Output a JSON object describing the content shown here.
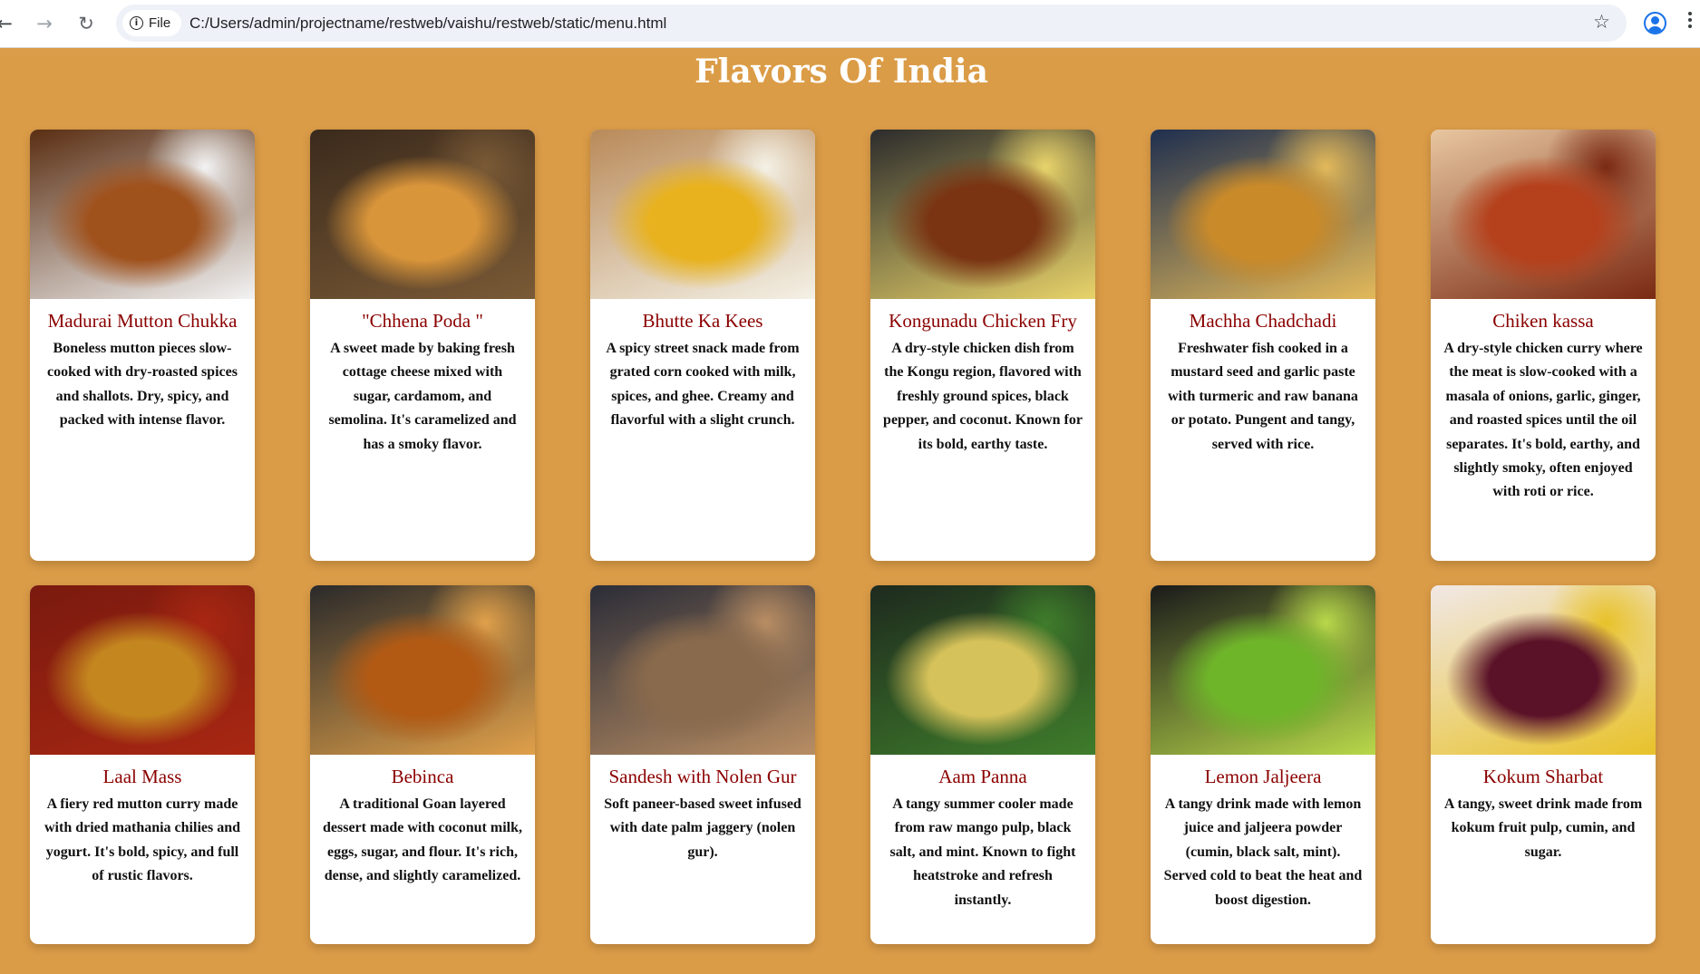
{
  "browser": {
    "file_label": "File",
    "url": "C:/Users/admin/projectname/restweb/vaishu/restweb/static/menu.html",
    "icons": [
      "back-arrow-icon",
      "forward-arrow-icon",
      "reload-icon",
      "info-icon",
      "star-icon",
      "profile-icon",
      "more-menu-icon"
    ]
  },
  "page": {
    "title": "Flavors Of India",
    "background_color": "#db9c47",
    "title_color": "#8b0000"
  },
  "dishes": [
    {
      "name": "Madurai Mutton Chukka",
      "desc": "Boneless mutton pieces slow-cooked with dry-roasted spices and shallots. Dry, spicy, and packed with intense flavor.",
      "colors": [
        "#5a2e12",
        "#a0521d",
        "#f3f3f3"
      ]
    },
    {
      "name": "\"Chhena Poda \"",
      "desc": "A sweet made by baking fresh cottage cheese mixed with sugar, cardamom, and semolina. It's caramelized and has a smoky flavor.",
      "colors": [
        "#3b2a1c",
        "#d9953a",
        "#7a5a36"
      ]
    },
    {
      "name": "Bhutte Ka Kees",
      "desc": "A spicy street snack made from grated corn cooked with milk, spices, and ghee. Creamy and flavorful with a slight crunch.",
      "colors": [
        "#b98a59",
        "#e8b21f",
        "#f4f1e6"
      ]
    },
    {
      "name": "Kongunadu Chicken Fry",
      "desc": "A dry-style chicken dish from the Kongu region, flavored with freshly ground spices, black pepper, and coconut. Known for its bold, earthy taste.",
      "colors": [
        "#2c2c2c",
        "#7a3412",
        "#e8d36a"
      ]
    },
    {
      "name": "Machha Chadchadi",
      "desc": "Freshwater fish cooked in a mustard seed and garlic paste with turmeric and raw banana or potato. Pungent and tangy, served with rice.",
      "colors": [
        "#1f2f4f",
        "#c98a2a",
        "#e3b95a"
      ]
    },
    {
      "name": "Chiken kassa",
      "desc": "A dry-style chicken curry where the meat is slow-cooked with a masala of onions, garlic, ginger, and roasted spices until the oil separates. It's bold, earthy, and slightly smoky, often enjoyed with roti or rice.",
      "colors": [
        "#e8c7a0",
        "#b5401c",
        "#7b2a12"
      ]
    },
    {
      "name": "Laal Mass",
      "desc": "A fiery red mutton curry made with dried mathania chilies and yogurt. It's bold, spicy, and full of rustic flavors.",
      "colors": [
        "#7a1a0f",
        "#c4861f",
        "#a82712"
      ]
    },
    {
      "name": "Bebinca",
      "desc": "A traditional Goan layered dessert made with coconut milk, eggs, sugar, and flour. It's rich, dense, and slightly caramelized.",
      "colors": [
        "#2a2a2a",
        "#b25a14",
        "#e0a04a"
      ]
    },
    {
      "name": "Sandesh with Nolen Gur",
      "desc": "Soft paneer-based sweet infused with date palm jaggery (nolen gur).",
      "colors": [
        "#2b2d38",
        "#8a6a4c",
        "#b88d63"
      ]
    },
    {
      "name": "Aam Panna",
      "desc": "A tangy summer cooler made from raw mango pulp, black salt, and mint. Known to fight heatstroke and refresh instantly.",
      "colors": [
        "#1e2a1e",
        "#d6c25a",
        "#3f7d2b"
      ]
    },
    {
      "name": "Lemon Jaljeera",
      "desc": "A tangy drink made with lemon juice and jaljeera powder (cumin, black salt, mint). Served cold to beat the heat and boost digestion.",
      "colors": [
        "#1a1a1a",
        "#6fb52a",
        "#b8d84a"
      ]
    },
    {
      "name": "Kokum Sharbat",
      "desc": "A tangy, sweet drink made from kokum fruit pulp, cumin, and sugar.",
      "colors": [
        "#f1e8e6",
        "#5a1228",
        "#e8c22a"
      ]
    }
  ]
}
